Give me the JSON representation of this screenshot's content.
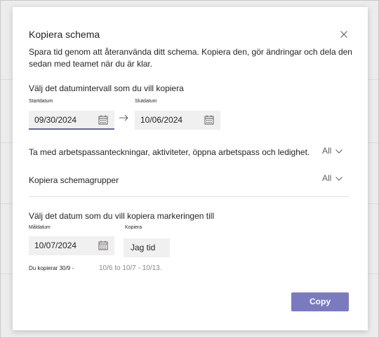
{
  "dialog": {
    "title": "Kopiera schema",
    "description": "Spara tid genom att återanvända ditt schema. Kopiera den, gör ändringar och dela den sedan med teamet när du är klar."
  },
  "source_range": {
    "heading": "Välj det datumintervall som du vill kopiera",
    "start_label": "Startdatum",
    "start_value": "09/30/2024",
    "end_label": "Slutdatum",
    "end_value": "10/06/2024"
  },
  "options": {
    "include_notes_label": "Ta med arbetspassanteckningar, aktiviteter, öppna arbetspass och ledighet.",
    "include_notes_value": "All",
    "groups_label": "Kopiera schemagrupper",
    "groups_value": "All"
  },
  "target": {
    "heading": "Välj det datum som du vill kopiera markeringen till",
    "target_label": "Måldatum",
    "target_value": "10/07/2024",
    "copies_label": "Kopiera",
    "copies_value": "Jag tid",
    "summary_prefix": "Du kopierar 30/9 -",
    "summary_range": "10/6 to 10/7 - 10/13."
  },
  "actions": {
    "copy_label": "Copy"
  },
  "colors": {
    "accent": "#6264a7",
    "button": "#7a7bbf"
  },
  "icons": [
    "close-icon",
    "calendar-icon",
    "arrow-right-icon",
    "chevron-down-icon"
  ]
}
